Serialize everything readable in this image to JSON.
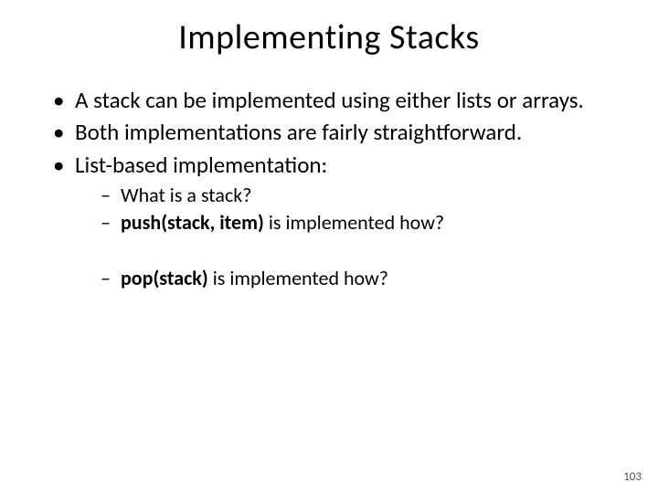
{
  "title": "Implementing Stacks",
  "bullets": {
    "b1": "A stack can be implemented using either lists or arrays.",
    "b2": "Both implementations are fairly straightforward.",
    "b3": "List-based implementation:",
    "s1": "What is a stack?",
    "s2a": "push(stack, item)",
    "s2b": " is implemented how?",
    "s3a": "pop(stack)",
    "s3b": " is implemented how?"
  },
  "page_number": "103"
}
